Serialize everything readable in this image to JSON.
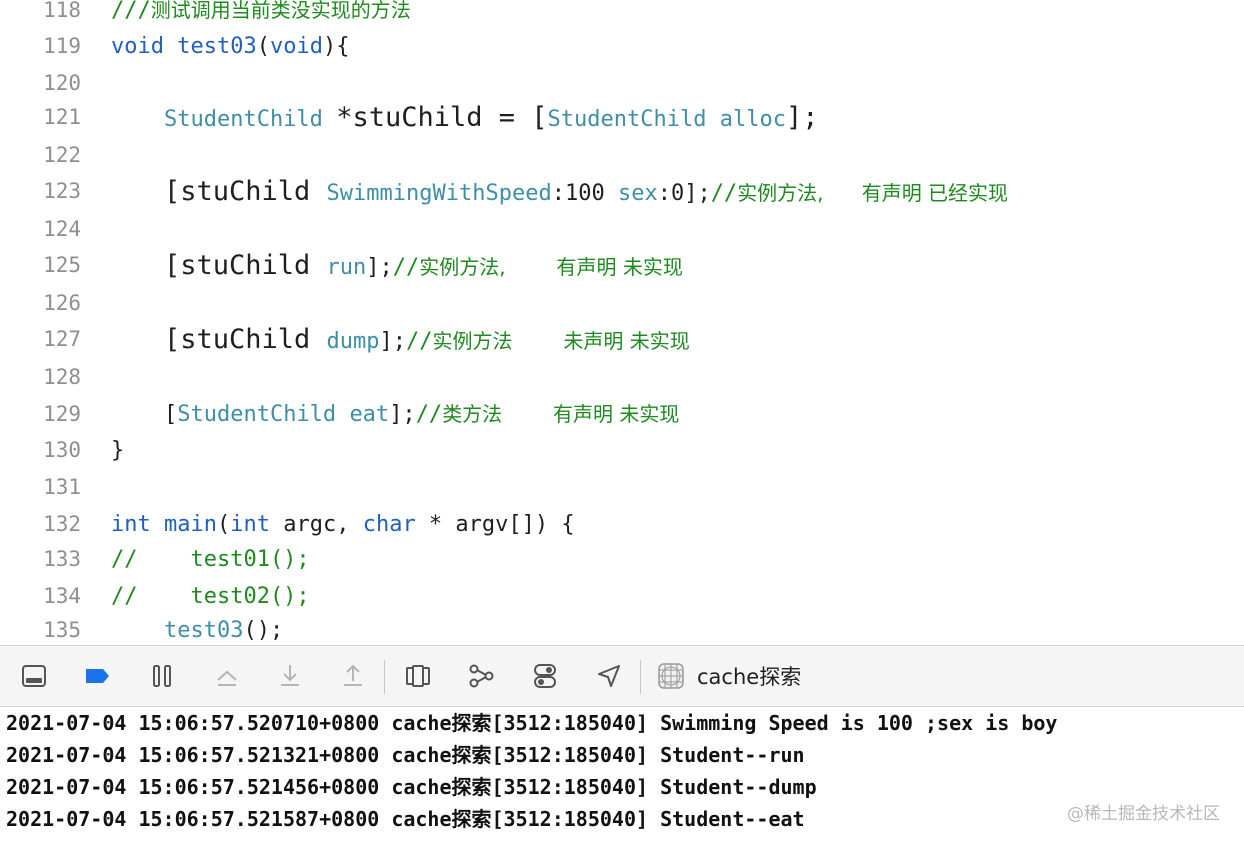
{
  "editor": {
    "lines": [
      {
        "num": "118",
        "parts": [
          [
            "cm",
            "///"
          ],
          [
            "cmt",
            "测试调用当前类没实现的方法"
          ]
        ]
      },
      {
        "num": "119",
        "parts": [
          [
            "kw",
            "void"
          ],
          [
            "",
            " "
          ],
          [
            "fn",
            "test03"
          ],
          [
            "",
            "("
          ],
          [
            "kw",
            "void"
          ],
          [
            "",
            "){"
          ]
        ]
      },
      {
        "num": "120",
        "parts": []
      },
      {
        "num": "121",
        "parts": [
          [
            "",
            "    "
          ],
          [
            "cls",
            "StudentChild"
          ],
          [
            "",
            " "
          ],
          [
            "big",
            "*stuChild = ["
          ],
          [
            "cls",
            "StudentChild"
          ],
          [
            "",
            " "
          ],
          [
            "sel",
            "alloc"
          ],
          [
            "big",
            "];"
          ]
        ]
      },
      {
        "num": "122",
        "parts": []
      },
      {
        "num": "123",
        "parts": [
          [
            "",
            "    "
          ],
          [
            "big",
            "[stuChild "
          ],
          [
            "sel",
            "SwimmingWithSpeed"
          ],
          [
            "",
            ":100 "
          ],
          [
            "sel",
            "sex"
          ],
          [
            "",
            ":0];"
          ],
          [
            "cm",
            "//"
          ],
          [
            "cmt",
            "实例方法,      有声明 已经实现"
          ]
        ]
      },
      {
        "num": "124",
        "parts": []
      },
      {
        "num": "125",
        "parts": [
          [
            "",
            "    "
          ],
          [
            "big",
            "[stuChild "
          ],
          [
            "sel",
            "run"
          ],
          [
            "",
            "];"
          ],
          [
            "cm",
            "//"
          ],
          [
            "cmt",
            "实例方法,        有声明 未实现"
          ]
        ]
      },
      {
        "num": "126",
        "parts": []
      },
      {
        "num": "127",
        "parts": [
          [
            "",
            "    "
          ],
          [
            "big",
            "[stuChild "
          ],
          [
            "sel",
            "dump"
          ],
          [
            "",
            "];"
          ],
          [
            "cm",
            "//"
          ],
          [
            "cmt",
            "实例方法        未声明 未实现"
          ]
        ]
      },
      {
        "num": "128",
        "parts": []
      },
      {
        "num": "129",
        "parts": [
          [
            "",
            "    ["
          ],
          [
            "cls",
            "StudentChild"
          ],
          [
            "",
            " "
          ],
          [
            "sel",
            "eat"
          ],
          [
            "",
            "];"
          ],
          [
            "cm",
            "//"
          ],
          [
            "cmt",
            "类方法        有声明 未实现"
          ]
        ]
      },
      {
        "num": "130",
        "parts": [
          [
            "",
            "}"
          ]
        ]
      },
      {
        "num": "131",
        "parts": []
      },
      {
        "num": "132",
        "parts": [
          [
            "kw",
            "int"
          ],
          [
            "",
            " "
          ],
          [
            "fn",
            "main"
          ],
          [
            "",
            "("
          ],
          [
            "kw",
            "int"
          ],
          [
            "",
            " argc, "
          ],
          [
            "kw",
            "char"
          ],
          [
            "",
            " * argv[]) {"
          ]
        ]
      },
      {
        "num": "133",
        "parts": [
          [
            "cm",
            "//    test01();"
          ]
        ]
      },
      {
        "num": "134",
        "parts": [
          [
            "cm",
            "//    test02();"
          ]
        ]
      },
      {
        "num": "135",
        "parts": [
          [
            "",
            "    "
          ],
          [
            "cls",
            "test03"
          ],
          [
            "",
            "();"
          ]
        ]
      }
    ]
  },
  "toolbar": {
    "buttons": [
      {
        "name": "hide-debug-area-icon",
        "interactable": true
      },
      {
        "name": "breakpoints-toggle-icon",
        "interactable": true
      },
      {
        "name": "pause-icon",
        "interactable": true
      },
      {
        "name": "step-over-icon",
        "interactable": true
      },
      {
        "name": "step-into-icon",
        "interactable": true
      },
      {
        "name": "step-out-icon",
        "interactable": true
      },
      {
        "name": "view-hierarchy-icon",
        "interactable": true
      },
      {
        "name": "memory-graph-icon",
        "interactable": true
      },
      {
        "name": "environment-overrides-icon",
        "interactable": true
      },
      {
        "name": "simulate-location-icon",
        "interactable": true
      }
    ],
    "target_label": "cache探索",
    "accent": "#1a73e8"
  },
  "console": {
    "lines": [
      "2021-07-04 15:06:57.520710+0800 cache探索[3512:185040] Swimming Speed is 100 ;sex is boy",
      "2021-07-04 15:06:57.521321+0800 cache探索[3512:185040] Student--run",
      "2021-07-04 15:06:57.521456+0800 cache探索[3512:185040] Student--dump",
      "2021-07-04 15:06:57.521587+0800 cache探索[3512:185040] Student--eat"
    ],
    "watermark": "@稀土掘金技术社区"
  }
}
